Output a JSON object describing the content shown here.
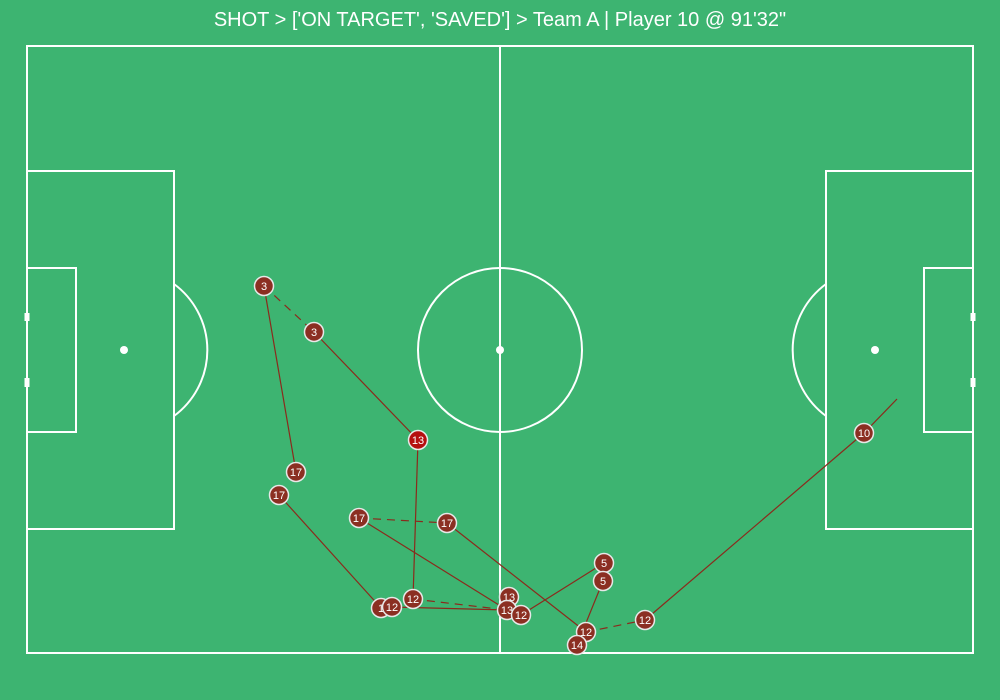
{
  "title": "SHOT > ['ON TARGET', 'SAVED'] > Team A | Player 10 @ 91'32\"",
  "colors": {
    "pitch": "#3db471",
    "lines": "#ffffff",
    "marker": "#8b2f22",
    "marker_highlight": "#b50f0f",
    "marker_stroke": "#e8e8e8",
    "link": "#8b2a1c"
  },
  "markers": [
    {
      "label": "3"
    },
    {
      "label": "3"
    },
    {
      "label": "13"
    },
    {
      "label": "17"
    },
    {
      "label": "17"
    },
    {
      "label": "17"
    },
    {
      "label": "17"
    },
    {
      "label": "1"
    },
    {
      "label": "12"
    },
    {
      "label": "12"
    },
    {
      "label": "13"
    },
    {
      "label": "13"
    },
    {
      "label": "12"
    },
    {
      "label": "5"
    },
    {
      "label": "5"
    },
    {
      "label": "12"
    },
    {
      "label": "14"
    },
    {
      "label": "12"
    },
    {
      "label": "10"
    }
  ]
}
